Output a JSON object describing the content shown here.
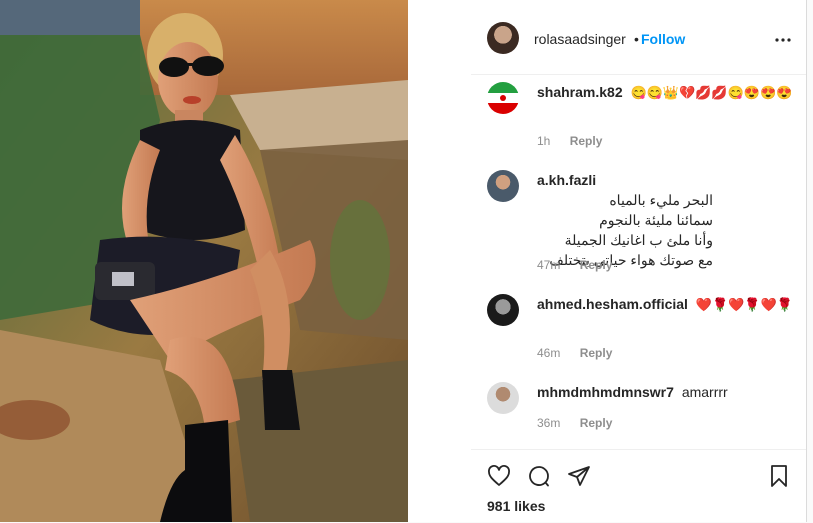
{
  "header": {
    "username": "rolasaadsinger",
    "separator": "•",
    "follow_label": "Follow",
    "more_icon": "more-icon"
  },
  "comments": [
    {
      "username": "shahram.k82",
      "text": "😋😋👑💔💋💋😋😍😍😍",
      "time": "1h",
      "reply": "Reply"
    },
    {
      "username": "a.kh.fazli",
      "lines": [
        "البحر مليء بالمياه",
        "سمائنا مليئة بالنجوم",
        "وأنا ملئ ب اغانيك الجميلة",
        "مع صوتك هواء حياتي بتختلف"
      ],
      "time": "47m",
      "reply": "Reply"
    },
    {
      "username": "ahmed.hesham.official",
      "text": "❤️🌹❤️🌹❤️🌹",
      "time": "46m",
      "reply": "Reply"
    },
    {
      "username": "mhmdmhmdmnswr7",
      "text": "amarrrr",
      "time": "36m",
      "reply": "Reply"
    }
  ],
  "actions": {
    "likes": "981 likes"
  }
}
